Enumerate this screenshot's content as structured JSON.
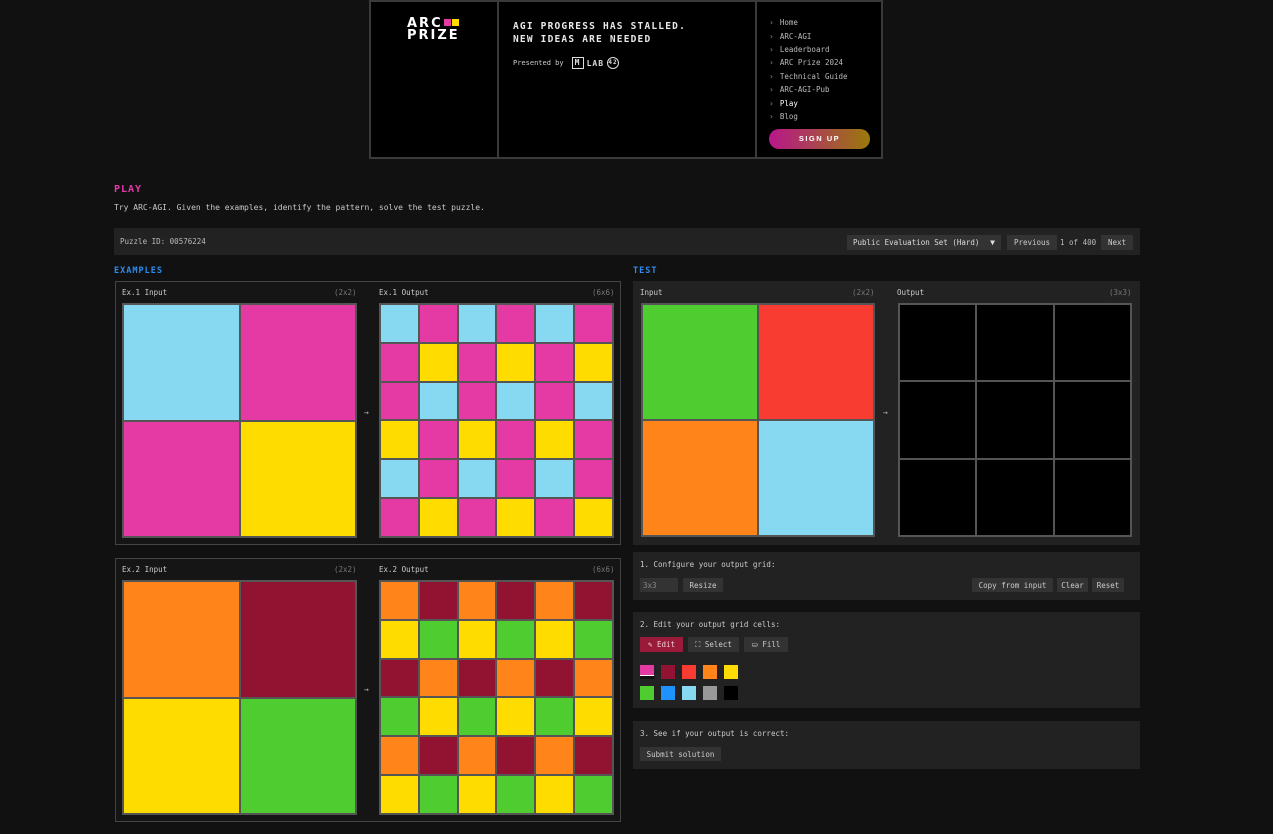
{
  "header": {
    "logo_line1": "ARC",
    "logo_line2": "PRIZE",
    "tagline_1": "AGI PROGRESS HAS STALLED.",
    "tagline_2": "NEW IDEAS ARE NEEDED",
    "presented_by": "Presented by",
    "lab_name": "LAB",
    "lab_badge": "42",
    "nav": [
      "Home",
      "ARC-AGI",
      "Leaderboard",
      "ARC Prize 2024",
      "Technical Guide",
      "ARC-AGI-Pub",
      "Play",
      "Blog"
    ],
    "active_nav": "Play",
    "signup": "SIGN UP"
  },
  "play": {
    "title": "PLAY",
    "description": "Try ARC-AGI. Given the examples, identify the pattern, solve the test puzzle."
  },
  "toolbar": {
    "puzzle_id": "Puzzle ID: 00576224",
    "set_selected": "Public Evaluation Set (Hard)",
    "previous": "Previous",
    "page": "1 of 400",
    "next": "Next"
  },
  "sections": {
    "examples": "EXAMPLES",
    "test": "TEST"
  },
  "colors": {
    "black": "#000000",
    "blue": "#1e93ff",
    "red": "#f93c31",
    "green": "#4fcc30",
    "yellow": "#ffdc00",
    "grey": "#999999",
    "magenta": "#e53aa3",
    "orange": "#ff851b",
    "cyan": "#87d8f1",
    "maroon": "#921231"
  },
  "examples": [
    {
      "input_label": "Ex.1 Input",
      "input_dim": "(2x2)",
      "output_label": "Ex.1 Output",
      "output_dim": "(6x6)",
      "input": [
        [
          "cyan",
          "magenta"
        ],
        [
          "magenta",
          "yellow"
        ]
      ],
      "output": [
        [
          "cyan",
          "magenta",
          "cyan",
          "magenta",
          "cyan",
          "magenta"
        ],
        [
          "magenta",
          "yellow",
          "magenta",
          "yellow",
          "magenta",
          "yellow"
        ],
        [
          "magenta",
          "cyan",
          "magenta",
          "cyan",
          "magenta",
          "cyan"
        ],
        [
          "yellow",
          "magenta",
          "yellow",
          "magenta",
          "yellow",
          "magenta"
        ],
        [
          "cyan",
          "magenta",
          "cyan",
          "magenta",
          "cyan",
          "magenta"
        ],
        [
          "magenta",
          "yellow",
          "magenta",
          "yellow",
          "magenta",
          "yellow"
        ]
      ]
    },
    {
      "input_label": "Ex.2 Input",
      "input_dim": "(2x2)",
      "output_label": "Ex.2 Output",
      "output_dim": "(6x6)",
      "input": [
        [
          "orange",
          "maroon"
        ],
        [
          "yellow",
          "green"
        ]
      ],
      "output": [
        [
          "orange",
          "maroon",
          "orange",
          "maroon",
          "orange",
          "maroon"
        ],
        [
          "yellow",
          "green",
          "yellow",
          "green",
          "yellow",
          "green"
        ],
        [
          "maroon",
          "orange",
          "maroon",
          "orange",
          "maroon",
          "orange"
        ],
        [
          "green",
          "yellow",
          "green",
          "yellow",
          "green",
          "yellow"
        ],
        [
          "orange",
          "maroon",
          "orange",
          "maroon",
          "orange",
          "maroon"
        ],
        [
          "yellow",
          "green",
          "yellow",
          "green",
          "yellow",
          "green"
        ]
      ]
    }
  ],
  "arrow": "→",
  "test": {
    "input_label": "Input",
    "input_dim": "(2x2)",
    "output_label": "Output",
    "output_dim": "(3x3)",
    "input": [
      [
        "green",
        "red"
      ],
      [
        "orange",
        "cyan"
      ]
    ],
    "output": [
      [
        "black",
        "black",
        "black"
      ],
      [
        "black",
        "black",
        "black"
      ],
      [
        "black",
        "black",
        "black"
      ]
    ]
  },
  "step1": {
    "label": "1. Configure your output grid:",
    "size_value": "3x3",
    "resize": "Resize",
    "copy_from_input": "Copy from input",
    "clear": "Clear",
    "reset": "Reset"
  },
  "step2": {
    "label": "2. Edit your output grid cells:",
    "edit": "Edit",
    "select": "Select",
    "fill": "Fill",
    "palette_row1": [
      "magenta",
      "maroon",
      "red",
      "orange",
      "yellow"
    ],
    "palette_row2": [
      "green",
      "blue",
      "cyan",
      "grey",
      "black"
    ],
    "selected_color": "magenta"
  },
  "step3": {
    "label": "3. See if your output is correct:",
    "submit": "Submit solution"
  }
}
